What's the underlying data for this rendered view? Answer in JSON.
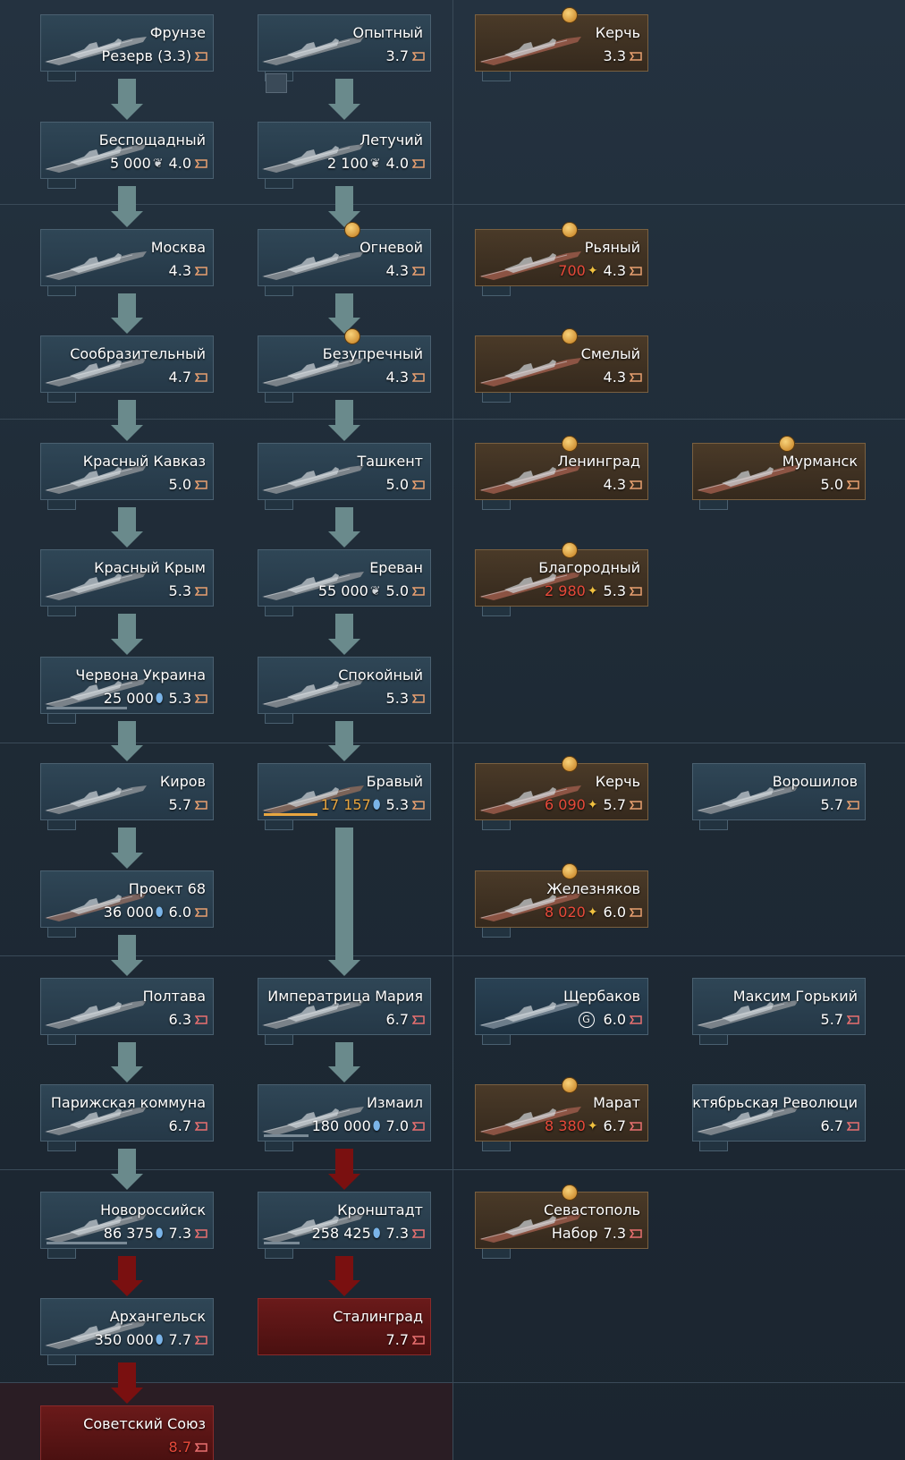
{
  "colors": {
    "arrow_normal": "#6a8a8c",
    "arrow_premium": "#7a1010",
    "researching": "#e8a640",
    "gold_price": "#e84a3a"
  },
  "ships": [
    {
      "id": "frunze",
      "name": "Фрунзе",
      "info": "Резерв (3.3)",
      "price": "",
      "currency": "",
      "br": "",
      "type": "reserve"
    },
    {
      "id": "opytny",
      "name": "Опытный",
      "info": "",
      "price": "",
      "currency": "",
      "br": "3.7",
      "type": "normal"
    },
    {
      "id": "kerch1",
      "name": "Керчь",
      "info": "",
      "price": "",
      "currency": "",
      "br": "3.3",
      "type": "premium"
    },
    {
      "id": "besposhchadny",
      "name": "Беспощадный",
      "info": "",
      "price": "5 000",
      "currency": "rp-icon",
      "br": "4.0",
      "type": "normal"
    },
    {
      "id": "letuchiy",
      "name": "Летучий",
      "info": "",
      "price": "2 100",
      "currency": "rp-icon",
      "br": "4.0",
      "type": "normal"
    },
    {
      "id": "moskva",
      "name": "Москва",
      "info": "",
      "price": "",
      "currency": "",
      "br": "4.3",
      "type": "normal"
    },
    {
      "id": "ognevoy",
      "name": "Огневой",
      "info": "",
      "price": "",
      "currency": "",
      "br": "4.3",
      "type": "normal"
    },
    {
      "id": "ryany",
      "name": "Рьяный",
      "info": "",
      "price": "700",
      "currency": "golden-eagle-icon",
      "br": "4.3",
      "type": "premium"
    },
    {
      "id": "soobrazitelny",
      "name": "Сообразительный",
      "info": "",
      "price": "",
      "currency": "",
      "br": "4.7",
      "type": "normal"
    },
    {
      "id": "bezuprechny",
      "name": "Безупречный",
      "info": "",
      "price": "",
      "currency": "",
      "br": "4.3",
      "type": "normal"
    },
    {
      "id": "smely",
      "name": "Смелый",
      "info": "",
      "price": "",
      "currency": "",
      "br": "4.3",
      "type": "premium"
    },
    {
      "id": "krasny_kavkaz",
      "name": "Красный Кавказ",
      "info": "",
      "price": "",
      "currency": "",
      "br": "5.0",
      "type": "normal"
    },
    {
      "id": "tashkent",
      "name": "Ташкент",
      "info": "",
      "price": "",
      "currency": "",
      "br": "5.0",
      "type": "normal"
    },
    {
      "id": "leningrad",
      "name": "Ленинград",
      "info": "",
      "price": "",
      "currency": "",
      "br": "4.3",
      "type": "premium"
    },
    {
      "id": "murmansk",
      "name": "Мурманск",
      "info": "",
      "price": "",
      "currency": "",
      "br": "5.0",
      "type": "premium"
    },
    {
      "id": "krasny_krym",
      "name": "Красный Крым",
      "info": "",
      "price": "",
      "currency": "",
      "br": "5.3",
      "type": "normal"
    },
    {
      "id": "erevan",
      "name": "Ереван",
      "info": "",
      "price": "55 000",
      "currency": "rp-icon",
      "br": "5.0",
      "type": "normal"
    },
    {
      "id": "blagorodny",
      "name": "Благородный",
      "info": "",
      "price": "2 980",
      "currency": "golden-eagle-icon",
      "br": "5.3",
      "type": "premium"
    },
    {
      "id": "chervona_ukraina",
      "name": "Червона Украина",
      "info": "",
      "price": "25 000",
      "currency": "sl-icon",
      "br": "5.3",
      "type": "normal"
    },
    {
      "id": "spokoyny",
      "name": "Спокойный",
      "info": "",
      "price": "",
      "currency": "",
      "br": "5.3",
      "type": "normal"
    },
    {
      "id": "kirov",
      "name": "Киров",
      "info": "",
      "price": "",
      "currency": "",
      "br": "5.7",
      "type": "normal"
    },
    {
      "id": "bravy",
      "name": "Бравый",
      "info": "",
      "price": "17 157",
      "currency": "sl-icon",
      "br": "5.3",
      "type": "researching"
    },
    {
      "id": "kerch2",
      "name": "Керчь",
      "info": "",
      "price": "6 090",
      "currency": "golden-eagle-icon",
      "br": "5.7",
      "type": "premium"
    },
    {
      "id": "voroshilov",
      "name": "Ворошилов",
      "info": "",
      "price": "",
      "currency": "",
      "br": "5.7",
      "type": "normal"
    },
    {
      "id": "proekt68",
      "name": "Проект 68",
      "info": "",
      "price": "36 000",
      "currency": "sl-icon",
      "br": "6.0",
      "type": "group"
    },
    {
      "id": "zheleznyakov",
      "name": "Железняков",
      "info": "",
      "price": "8 020",
      "currency": "golden-eagle-icon",
      "br": "6.0",
      "type": "premium"
    },
    {
      "id": "poltava",
      "name": "Полтава",
      "info": "",
      "price": "",
      "currency": "",
      "br": "6.3",
      "type": "normal"
    },
    {
      "id": "imperatritsa_mariya",
      "name": "Императрица Мария",
      "info": "",
      "price": "",
      "currency": "",
      "br": "6.7",
      "type": "normal"
    },
    {
      "id": "shcherbakov",
      "name": "Щербаков",
      "info": "",
      "price": "",
      "currency": "gaijin-icon",
      "br": "6.0",
      "type": "squadron"
    },
    {
      "id": "maksim_gorky",
      "name": "Максим Горький",
      "info": "",
      "price": "",
      "currency": "",
      "br": "5.7",
      "type": "normal"
    },
    {
      "id": "parizhskaya_kommuna",
      "name": "Парижская коммуна",
      "info": "",
      "price": "",
      "currency": "",
      "br": "6.7",
      "type": "normal"
    },
    {
      "id": "izmail",
      "name": "Измаил",
      "info": "",
      "price": "180 000",
      "currency": "sl-icon",
      "br": "7.0",
      "type": "normal"
    },
    {
      "id": "marat",
      "name": "Марат",
      "info": "",
      "price": "8 380",
      "currency": "golden-eagle-icon",
      "br": "6.7",
      "type": "premium"
    },
    {
      "id": "oktyabrskaya",
      "name": "Октябрьская Революци",
      "info": "",
      "price": "",
      "currency": "",
      "br": "6.7",
      "type": "normal"
    },
    {
      "id": "novorossiysk",
      "name": "Новороссийск",
      "info": "",
      "price": "86 375",
      "currency": "sl-icon",
      "br": "7.3",
      "type": "normal"
    },
    {
      "id": "kronshtadt",
      "name": "Кронштадт",
      "info": "",
      "price": "258 425",
      "currency": "sl-icon",
      "br": "7.3",
      "type": "normal"
    },
    {
      "id": "sevastopol",
      "name": "Севастополь",
      "info": "Набор",
      "price": "",
      "currency": "",
      "br": "7.3",
      "type": "premium"
    },
    {
      "id": "arkhangelsk",
      "name": "Архангельск",
      "info": "",
      "price": "350 000",
      "currency": "sl-icon",
      "br": "7.7",
      "type": "normal"
    },
    {
      "id": "stalingrad",
      "name": "Сталинград",
      "info": "",
      "price": "",
      "currency": "",
      "br": "7.7",
      "type": "event"
    },
    {
      "id": "sovetsky_soyuz",
      "name": "Советский Союз",
      "info": "",
      "price": "",
      "currency": "",
      "br": "8.7",
      "type": "event"
    }
  ]
}
